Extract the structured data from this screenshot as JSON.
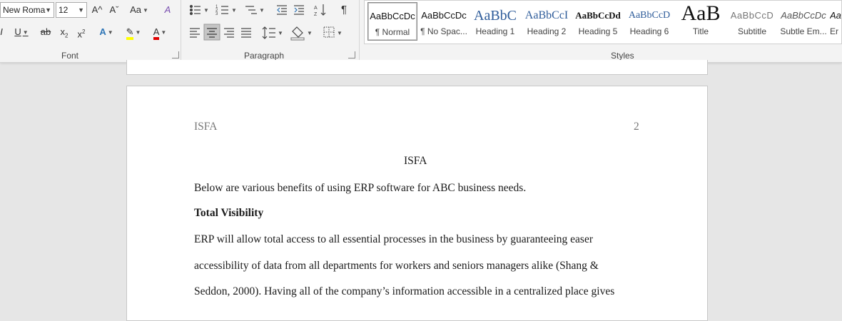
{
  "ribbon": {
    "font_group": {
      "label": "Font",
      "font_name": "New Roma",
      "font_size": "12",
      "grow_font": "A^",
      "shrink_font": "Aˇ",
      "change_case": "Aa",
      "clear_format": "A",
      "bold_partial": "I",
      "underline": "U",
      "strikethrough": "ab",
      "subscript": "x",
      "subscript_mark": "2",
      "superscript": "x",
      "superscript_mark": "2",
      "text_effects": "A",
      "highlight": "✎",
      "font_color": "A",
      "highlight_color": "#ffff00",
      "font_color_value": "#e00000"
    },
    "paragraph_group": {
      "label": "Paragraph",
      "pilcrow": "¶",
      "sort": "↓"
    },
    "styles_group": {
      "label": "Styles",
      "items": [
        {
          "sample": "AaBbCcDc",
          "name": "¶ Normal"
        },
        {
          "sample": "AaBbCcDc",
          "name": "¶ No Spac..."
        },
        {
          "sample": "AaBbC",
          "name": "Heading 1"
        },
        {
          "sample": "AaBbCcI",
          "name": "Heading 2"
        },
        {
          "sample": "AaBbCcDd",
          "name": "Heading 5"
        },
        {
          "sample": "AaBbCcD",
          "name": "Heading 6"
        },
        {
          "sample": "AaB",
          "name": "Title"
        },
        {
          "sample": "AaBbCcD",
          "name": "Subtitle"
        },
        {
          "sample": "AaBbCcDc",
          "name": "Subtle Em..."
        },
        {
          "sample": "Aa",
          "name": "Er"
        }
      ]
    }
  },
  "document": {
    "header_left": "ISFA",
    "header_right": "2",
    "title": "ISFA",
    "paragraph1": "Below are various benefits of using ERP software for ABC business needs.",
    "heading1": "Total Visibility",
    "body_lines": [
      "ERP will allow total access to all essential processes in the business by guaranteeing easer",
      "accessibility of data from all departments for workers and seniors managers alike (Shang &",
      "Seddon, 2000). Having all of the company’s information accessible in a centralized place gives"
    ]
  }
}
